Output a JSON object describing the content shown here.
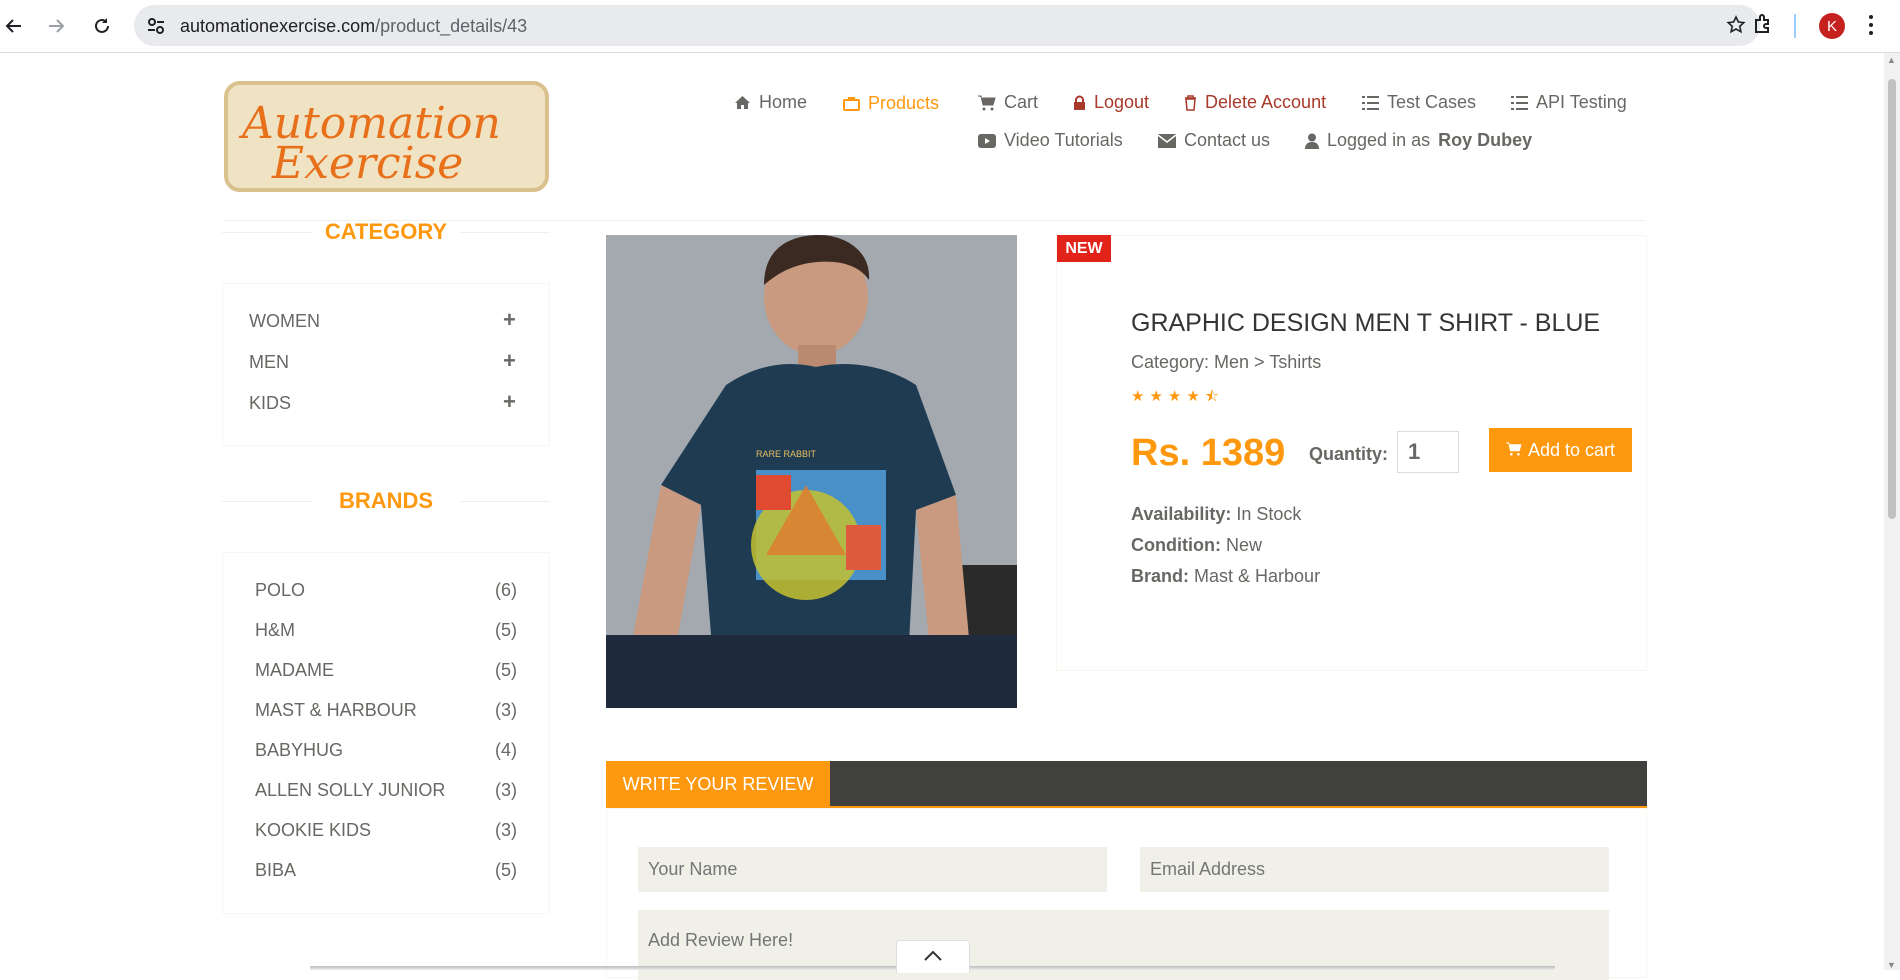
{
  "browser": {
    "url_host": "automationexercise.com",
    "url_path": "/product_details/43",
    "profile_initial": "K"
  },
  "logo": {
    "line1": "Automation",
    "line2": "Exercise"
  },
  "nav": {
    "home": "Home",
    "products": "Products",
    "cart": "Cart",
    "logout": "Logout",
    "delete_account": "Delete Account",
    "test_cases": "Test Cases",
    "api_testing": "API Testing",
    "video_tutorials": "Video Tutorials",
    "contact_us": "Contact us",
    "logged_in_prefix": "Logged in as",
    "logged_in_user": "Roy Dubey"
  },
  "sidebar": {
    "category_title": "CATEGORY",
    "categories": [
      "WOMEN",
      "MEN",
      "KIDS"
    ],
    "brands_title": "BRANDS",
    "brands": [
      {
        "name": "POLO",
        "count": "(6)"
      },
      {
        "name": "H&M",
        "count": "(5)"
      },
      {
        "name": "MADAME",
        "count": "(5)"
      },
      {
        "name": "MAST & HARBOUR",
        "count": "(3)"
      },
      {
        "name": "BABYHUG",
        "count": "(4)"
      },
      {
        "name": "ALLEN SOLLY JUNIOR",
        "count": "(3)"
      },
      {
        "name": "KOOKIE KIDS",
        "count": "(3)"
      },
      {
        "name": "BIBA",
        "count": "(5)"
      }
    ]
  },
  "product": {
    "badge": "NEW",
    "name": "GRAPHIC DESIGN MEN T SHIRT - BLUE",
    "category": "Category: Men > Tshirts",
    "rating": 4.5,
    "price": "Rs. 1389",
    "quantity_label": "Quantity:",
    "quantity": "1",
    "add_to_cart": "Add to cart",
    "availability_label": "Availability:",
    "availability": "In Stock",
    "condition_label": "Condition:",
    "condition": "New",
    "brand_label": "Brand:",
    "brand": "Mast & Harbour",
    "shirt_print": "RARE RABBIT"
  },
  "review": {
    "tab": "WRITE YOUR REVIEW",
    "name_placeholder": "Your Name",
    "email_placeholder": "Email Address",
    "review_placeholder": "Add Review Here!"
  },
  "colors": {
    "accent": "#fe980f",
    "badge": "#e2231a",
    "dark_bar": "#40403e",
    "danger_nav": "#a9392a"
  }
}
